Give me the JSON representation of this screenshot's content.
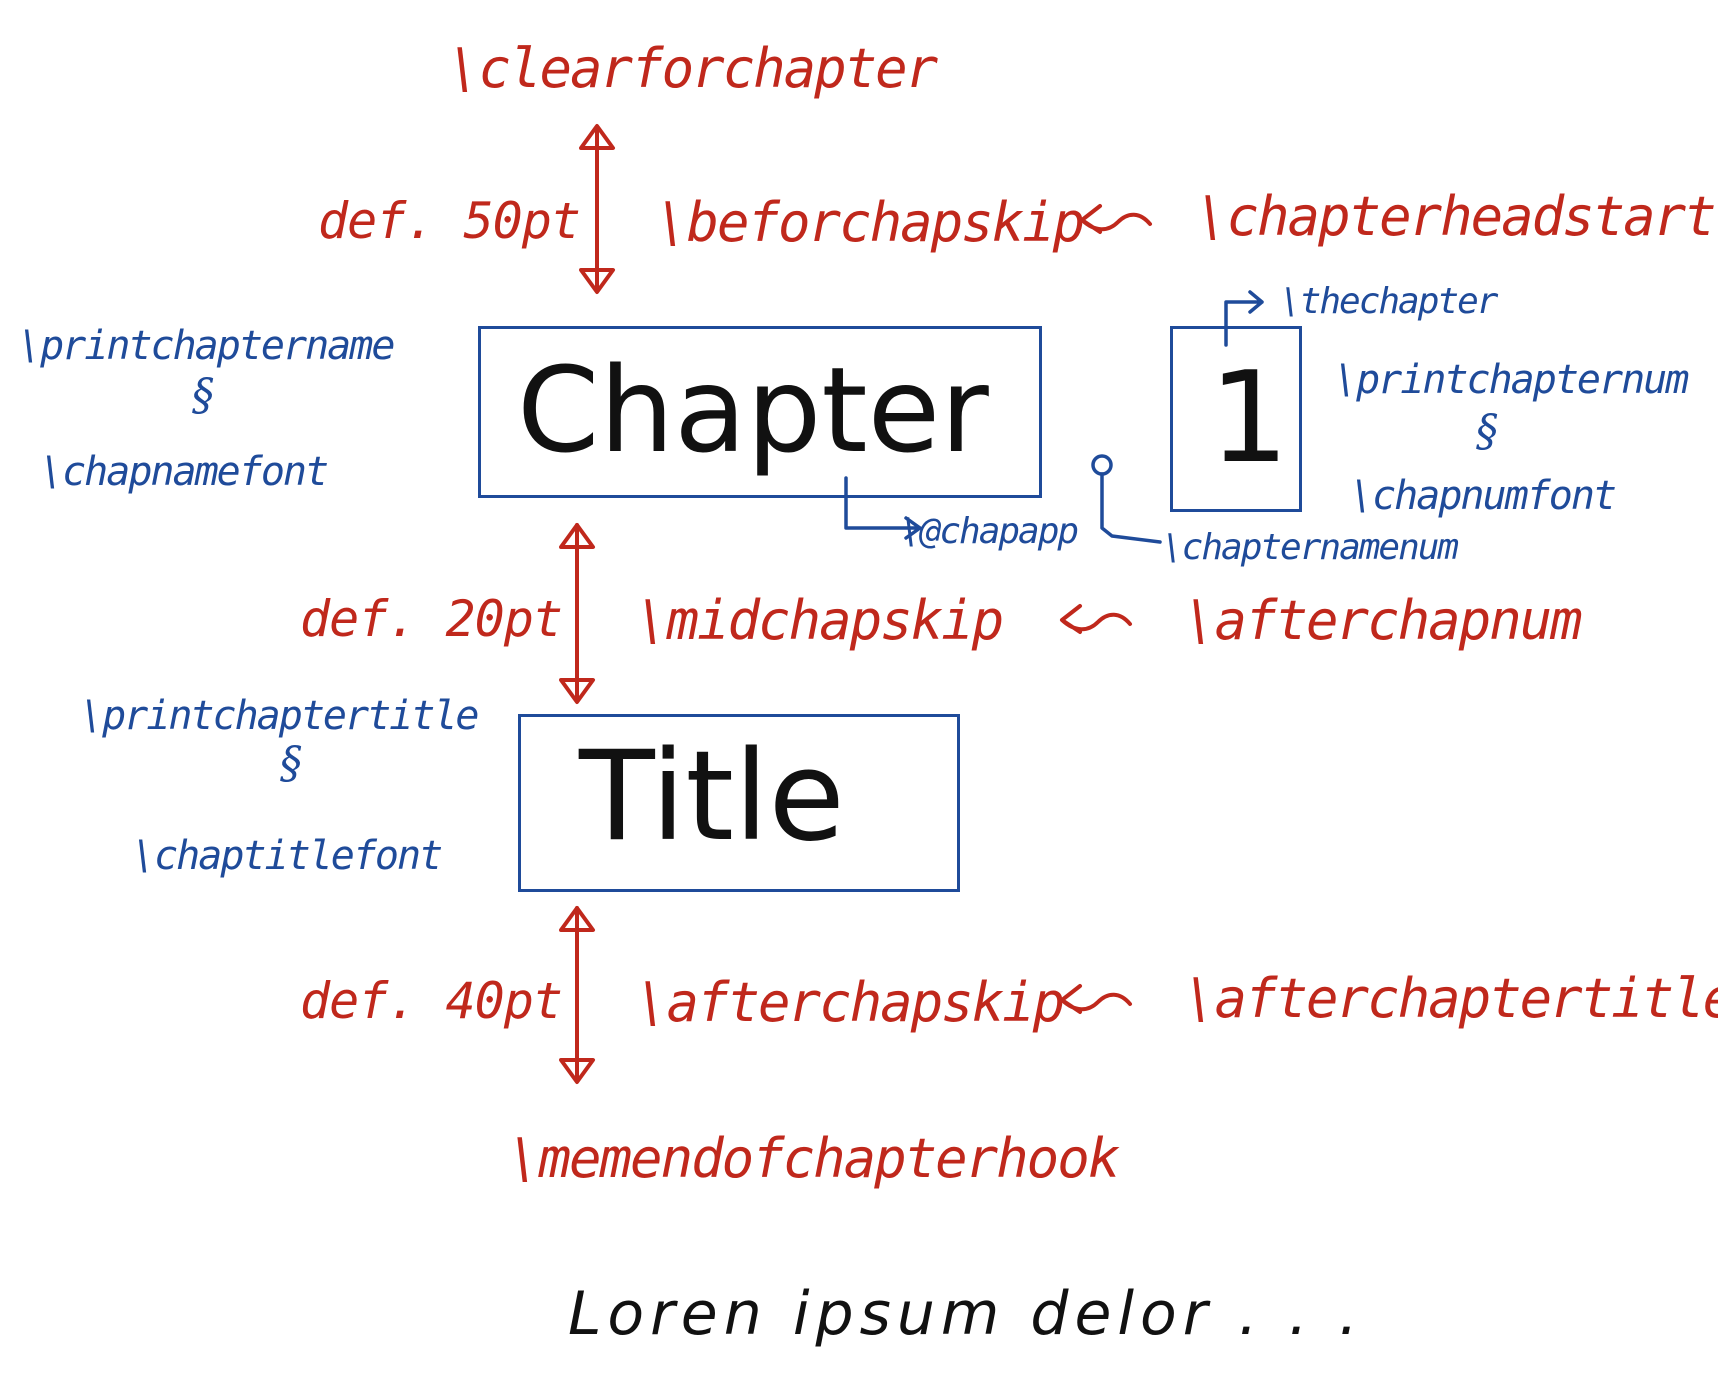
{
  "hooks": {
    "clearforchapter": "\\clearforchapter",
    "beforchapskip": "\\beforchapskip",
    "chapterheadstart": "\\chapterheadstart",
    "midchapskip": "\\midchapskip",
    "afterchapnum": "\\afterchapnum",
    "afterchapskip": "\\afterchapskip",
    "afterchaptertitle": "\\afterchaptertitle",
    "memendofchapterhook": "\\memendofchapterhook"
  },
  "dimensions": {
    "before": "def. 50pt",
    "mid": "def. 20pt",
    "after": "def. 40pt"
  },
  "boxes": {
    "chapter_word": "Chapter",
    "chapter_number": "1",
    "title_word": "Title"
  },
  "fonts": {
    "printchaptername": "\\printchaptername",
    "chapnamefont": "\\chapnamefont",
    "printchapternum": "\\printchapternum",
    "chapnumfont": "\\chapnumfont",
    "printchaptertitle": "\\printchaptertitle",
    "chaptitlefont": "\\chaptitlefont",
    "thechapter": "\\thechapter",
    "chapapp": "\\@chapapp",
    "chapternamenum": "\\chapternamenum",
    "contains_symbol": "§"
  },
  "body_text": "Loren ipsum delor . . .",
  "colors": {
    "hook_red": "#c0281c",
    "font_blue": "#1f4b9a",
    "ink_black": "#111111"
  }
}
